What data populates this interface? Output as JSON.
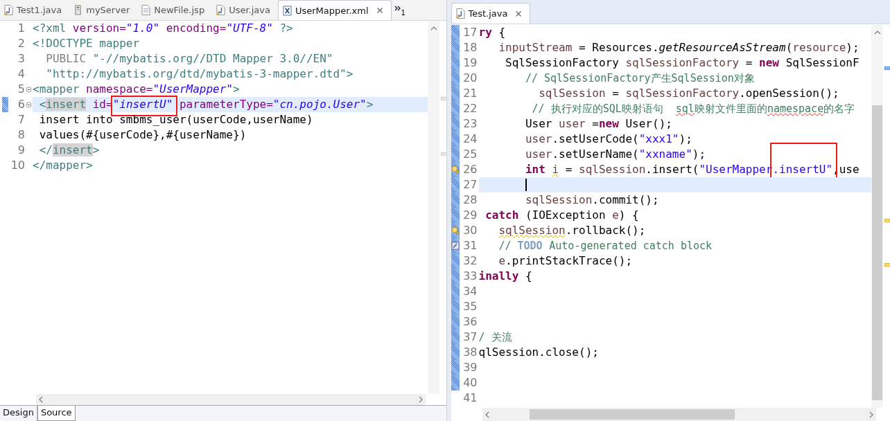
{
  "left_editor": {
    "tabs": [
      {
        "label": "Test1.java",
        "kind": "java",
        "selected": false
      },
      {
        "label": "myServer",
        "kind": "server",
        "selected": false
      },
      {
        "label": "NewFile.jsp",
        "kind": "jsp",
        "selected": false
      },
      {
        "label": "User.java",
        "kind": "java",
        "selected": false
      },
      {
        "label": "UserMapper.xml",
        "kind": "xml",
        "selected": true
      }
    ],
    "overflow_count": "1",
    "lines": [
      {
        "n": "1",
        "fold": false,
        "changed": false,
        "current": false,
        "tokens": [
          {
            "kind": "tag",
            "text": "<?xml "
          },
          {
            "kind": "attr",
            "text": "version="
          },
          {
            "kind": "value",
            "text": "\"1.0\""
          },
          {
            "kind": "attr",
            "text": " encoding="
          },
          {
            "kind": "value",
            "text": "\"UTF-8\""
          },
          {
            "kind": "tag",
            "text": " ?>"
          }
        ]
      },
      {
        "n": "2",
        "fold": false,
        "changed": false,
        "current": false,
        "tokens": [
          {
            "kind": "tag",
            "text": "<!DOCTYPE mapper"
          }
        ]
      },
      {
        "n": "3",
        "fold": false,
        "changed": false,
        "current": false,
        "tokens": [
          {
            "kind": "muted",
            "text": "  PUBLIC "
          },
          {
            "kind": "doctype",
            "text": "\"-//mybatis.org//DTD Mapper 3.0//EN\""
          }
        ]
      },
      {
        "n": "4",
        "fold": false,
        "changed": false,
        "current": false,
        "tokens": [
          {
            "kind": "doctype",
            "text": "  \"http://mybatis.org/dtd/mybatis-3-mapper.dtd\""
          },
          {
            "kind": "tag",
            "text": ">"
          }
        ]
      },
      {
        "n": "5",
        "fold": true,
        "changed": false,
        "current": false,
        "tokens": [
          {
            "kind": "tag",
            "text": "<mapper "
          },
          {
            "kind": "attr",
            "text": "namespace="
          },
          {
            "kind": "value",
            "text": "\"UserMapper\""
          },
          {
            "kind": "tag",
            "text": ">"
          }
        ]
      },
      {
        "n": "6",
        "fold": true,
        "changed": true,
        "current": true,
        "tokens": [
          {
            "kind": "tag",
            "text": " <"
          },
          {
            "kind": "tag",
            "text": "insert",
            "occurrence": true
          },
          {
            "kind": "attr",
            "text": " id="
          },
          {
            "kind": "value",
            "text": "\"insertU\"",
            "boxed": true
          },
          {
            "kind": "attr",
            "text": " parameterType="
          },
          {
            "kind": "value",
            "text": "\"cn.pojo.User\""
          },
          {
            "kind": "tag",
            "text": ">"
          }
        ]
      },
      {
        "n": "7",
        "fold": false,
        "changed": false,
        "current": false,
        "tokens": [
          {
            "kind": "plain",
            "text": " insert into smbms_user(userCode,userName)"
          }
        ]
      },
      {
        "n": "8",
        "fold": false,
        "changed": false,
        "current": false,
        "tokens": [
          {
            "kind": "plain",
            "text": " values(#{userCode},#{userName})"
          }
        ]
      },
      {
        "n": "9",
        "fold": false,
        "changed": false,
        "current": false,
        "tokens": [
          {
            "kind": "tag",
            "text": " </"
          },
          {
            "kind": "tag",
            "text": "insert",
            "occurrence": true
          },
          {
            "kind": "tag",
            "text": ">"
          }
        ]
      },
      {
        "n": "10",
        "fold": false,
        "changed": false,
        "current": false,
        "tokens": [
          {
            "kind": "tag",
            "text": "</mapper>"
          }
        ]
      }
    ],
    "bottom_tabs": [
      {
        "label": "Design",
        "selected": false
      },
      {
        "label": "Source",
        "selected": true
      }
    ]
  },
  "right_editor": {
    "tabs": [
      {
        "label": "Test.java",
        "kind": "java",
        "selected": true
      }
    ],
    "lines": [
      {
        "n": "17",
        "changed": true,
        "current": false,
        "tokens": [
          {
            "kind": "keyword",
            "text": "ry"
          },
          {
            "kind": "plain",
            "text": " {"
          }
        ]
      },
      {
        "n": "18",
        "changed": true,
        "current": false,
        "tokens": [
          {
            "kind": "var",
            "text": "   inputStream"
          },
          {
            "kind": "plain",
            "text": " = Resources."
          },
          {
            "kind": "method",
            "text": "getResourceAsStream"
          },
          {
            "kind": "plain",
            "text": "("
          },
          {
            "kind": "var",
            "text": "resource"
          },
          {
            "kind": "plain",
            "text": ");"
          }
        ]
      },
      {
        "n": "19",
        "changed": true,
        "current": false,
        "tokens": [
          {
            "kind": "plain",
            "text": "    SqlSessionFactory "
          },
          {
            "kind": "var",
            "text": "sqlSessionFactory"
          },
          {
            "kind": "plain",
            "text": " = "
          },
          {
            "kind": "keyword",
            "text": "new"
          },
          {
            "kind": "plain",
            "text": " SqlSessionF"
          }
        ]
      },
      {
        "n": "20",
        "changed": true,
        "current": false,
        "tokens": [
          {
            "kind": "comment",
            "text": "       // SqlSessionFactory产生SqlSession对象"
          }
        ]
      },
      {
        "n": "21",
        "changed": true,
        "current": false,
        "tokens": [
          {
            "kind": "var",
            "text": "         sqlSession"
          },
          {
            "kind": "plain",
            "text": " = "
          },
          {
            "kind": "var",
            "text": "sqlSessionFactory"
          },
          {
            "kind": "plain",
            "text": ".openSession();"
          }
        ]
      },
      {
        "n": "22",
        "changed": true,
        "current": false,
        "tokens": [
          {
            "kind": "comment",
            "text": "        // 执行对应的SQL映射语句  "
          },
          {
            "kind": "comment",
            "text": "sql",
            "underline": {
              "kind": "error"
            }
          },
          {
            "kind": "comment",
            "text": "映射文件里面的"
          },
          {
            "kind": "comment",
            "text": "namespace",
            "underline": {
              "kind": "error"
            }
          },
          {
            "kind": "comment",
            "text": "的名字"
          }
        ]
      },
      {
        "n": "23",
        "changed": true,
        "current": false,
        "tokens": [
          {
            "kind": "plain",
            "text": "       User "
          },
          {
            "kind": "var",
            "text": "user"
          },
          {
            "kind": "plain",
            "text": " ="
          },
          {
            "kind": "keyword",
            "text": "new"
          },
          {
            "kind": "plain",
            "text": " User();"
          }
        ]
      },
      {
        "n": "24",
        "changed": true,
        "current": false,
        "tokens": [
          {
            "kind": "var",
            "text": "       user"
          },
          {
            "kind": "plain",
            "text": ".setUserCode("
          },
          {
            "kind": "string",
            "text": "\"xxx1\""
          },
          {
            "kind": "plain",
            "text": ");"
          }
        ]
      },
      {
        "n": "25",
        "changed": true,
        "current": false,
        "tokens": [
          {
            "kind": "var",
            "text": "       user"
          },
          {
            "kind": "plain",
            "text": ".setUserName("
          },
          {
            "kind": "string",
            "text": "\"xxname\""
          },
          {
            "kind": "plain",
            "text": ");"
          }
        ]
      },
      {
        "n": "26",
        "changed": true,
        "current": false,
        "marker": {
          "kind": "warning"
        },
        "tokens": [
          {
            "kind": "keyword",
            "text": "       int "
          },
          {
            "kind": "var",
            "text": "i",
            "underline": {
              "kind": "warning"
            }
          },
          {
            "kind": "plain",
            "text": " = "
          },
          {
            "kind": "var",
            "text": "sqlSession"
          },
          {
            "kind": "plain",
            "text": ".insert("
          },
          {
            "kind": "string",
            "text": "\"UserMapper"
          },
          {
            "kind": "string",
            "text": ".insertU\"",
            "boxed": true
          },
          {
            "kind": "plain",
            "text": ",use"
          }
        ]
      },
      {
        "n": "27",
        "changed": true,
        "current": true,
        "caret": true
      },
      {
        "n": "28",
        "changed": true,
        "current": false,
        "tokens": [
          {
            "kind": "var",
            "text": "       sqlSession"
          },
          {
            "kind": "plain",
            "text": ".commit();"
          }
        ]
      },
      {
        "n": "29",
        "changed": true,
        "current": false,
        "tokens": [
          {
            "kind": "keyword",
            "text": " catch"
          },
          {
            "kind": "plain",
            "text": " (IOException "
          },
          {
            "kind": "var",
            "text": "e"
          },
          {
            "kind": "plain",
            "text": ") {"
          }
        ]
      },
      {
        "n": "30",
        "changed": true,
        "current": false,
        "marker": {
          "kind": "warning"
        },
        "tokens": [
          {
            "kind": "var",
            "text": "   sqlSession",
            "underline": {
              "kind": "warning"
            }
          },
          {
            "kind": "plain",
            "text": ".rollback();"
          }
        ]
      },
      {
        "n": "31",
        "changed": true,
        "current": false,
        "marker": {
          "kind": "task"
        },
        "tokens": [
          {
            "kind": "comment",
            "text": "   // "
          },
          {
            "kind": "todo",
            "text": "TODO"
          },
          {
            "kind": "comment",
            "text": " Auto-generated catch block"
          }
        ]
      },
      {
        "n": "32",
        "changed": true,
        "current": false,
        "tokens": [
          {
            "kind": "var",
            "text": "   e"
          },
          {
            "kind": "plain",
            "text": ".printStackTrace();"
          }
        ]
      },
      {
        "n": "33",
        "changed": true,
        "current": false,
        "tokens": [
          {
            "kind": "keyword",
            "text": "inally"
          },
          {
            "kind": "plain",
            "text": " {"
          }
        ]
      },
      {
        "n": "34",
        "changed": true,
        "current": false
      },
      {
        "n": "35",
        "changed": true,
        "current": false
      },
      {
        "n": "36",
        "changed": true,
        "current": false
      },
      {
        "n": "37",
        "changed": true,
        "current": false,
        "tokens": [
          {
            "kind": "comment",
            "text": "/ 关流"
          }
        ]
      },
      {
        "n": "38",
        "changed": true,
        "current": false,
        "tokens": [
          {
            "kind": "plain",
            "text": "qlSession.close();"
          }
        ]
      },
      {
        "n": "39",
        "changed": true,
        "current": false
      },
      {
        "n": "40",
        "changed": true,
        "current": false
      },
      {
        "n": "41",
        "changed": false,
        "current": false
      }
    ]
  }
}
